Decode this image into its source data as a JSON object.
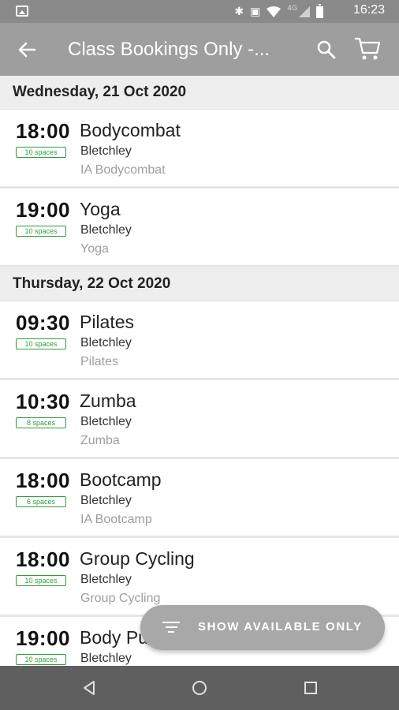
{
  "status_bar": {
    "network_label": "4G",
    "time": "16:23",
    "icons": [
      "image-icon",
      "bluetooth-icon",
      "nfc-icon",
      "wifi-icon",
      "signal-icon",
      "battery-icon"
    ]
  },
  "app_bar": {
    "title": "Class Bookings Only -...",
    "icons": [
      "back-arrow-icon",
      "search-icon",
      "cart-icon"
    ]
  },
  "sections": [
    {
      "date": "Wednesday, 21 Oct 2020",
      "classes": [
        {
          "time": "18:00",
          "spaces": "10 spaces",
          "name": "Bodycombat",
          "location": "Bletchley",
          "subtitle": "IA Bodycombat"
        },
        {
          "time": "19:00",
          "spaces": "10 spaces",
          "name": "Yoga",
          "location": "Bletchley",
          "subtitle": "Yoga"
        }
      ]
    },
    {
      "date": "Thursday, 22 Oct 2020",
      "classes": [
        {
          "time": "09:30",
          "spaces": "10 spaces",
          "name": "Pilates",
          "location": "Bletchley",
          "subtitle": "Pilates"
        },
        {
          "time": "10:30",
          "spaces": "8 spaces",
          "name": "Zumba",
          "location": "Bletchley",
          "subtitle": "Zumba"
        },
        {
          "time": "18:00",
          "spaces": "6 spaces",
          "name": "Bootcamp",
          "location": "Bletchley",
          "subtitle": "IA Bootcamp"
        },
        {
          "time": "18:00",
          "spaces": "10 spaces",
          "name": "Group Cycling",
          "location": "Bletchley",
          "subtitle": "Group Cycling"
        },
        {
          "time": "19:00",
          "spaces": "10 spaces",
          "name": "Body Pu",
          "location": "Bletchley",
          "subtitle": ""
        }
      ]
    }
  ],
  "fab": {
    "label": "SHOW AVAILABLE ONLY",
    "icon": "filter-icon"
  },
  "nav_bar": {
    "icons": [
      "back-triangle-icon",
      "home-circle-icon",
      "recents-square-icon"
    ]
  },
  "colors": {
    "app_bar": "#9e9e9e",
    "status_bar": "#8a8a8a",
    "badge_green": "#2e9e3a",
    "fab": "#a8a8a8",
    "nav_bar": "#5f5f5f"
  }
}
